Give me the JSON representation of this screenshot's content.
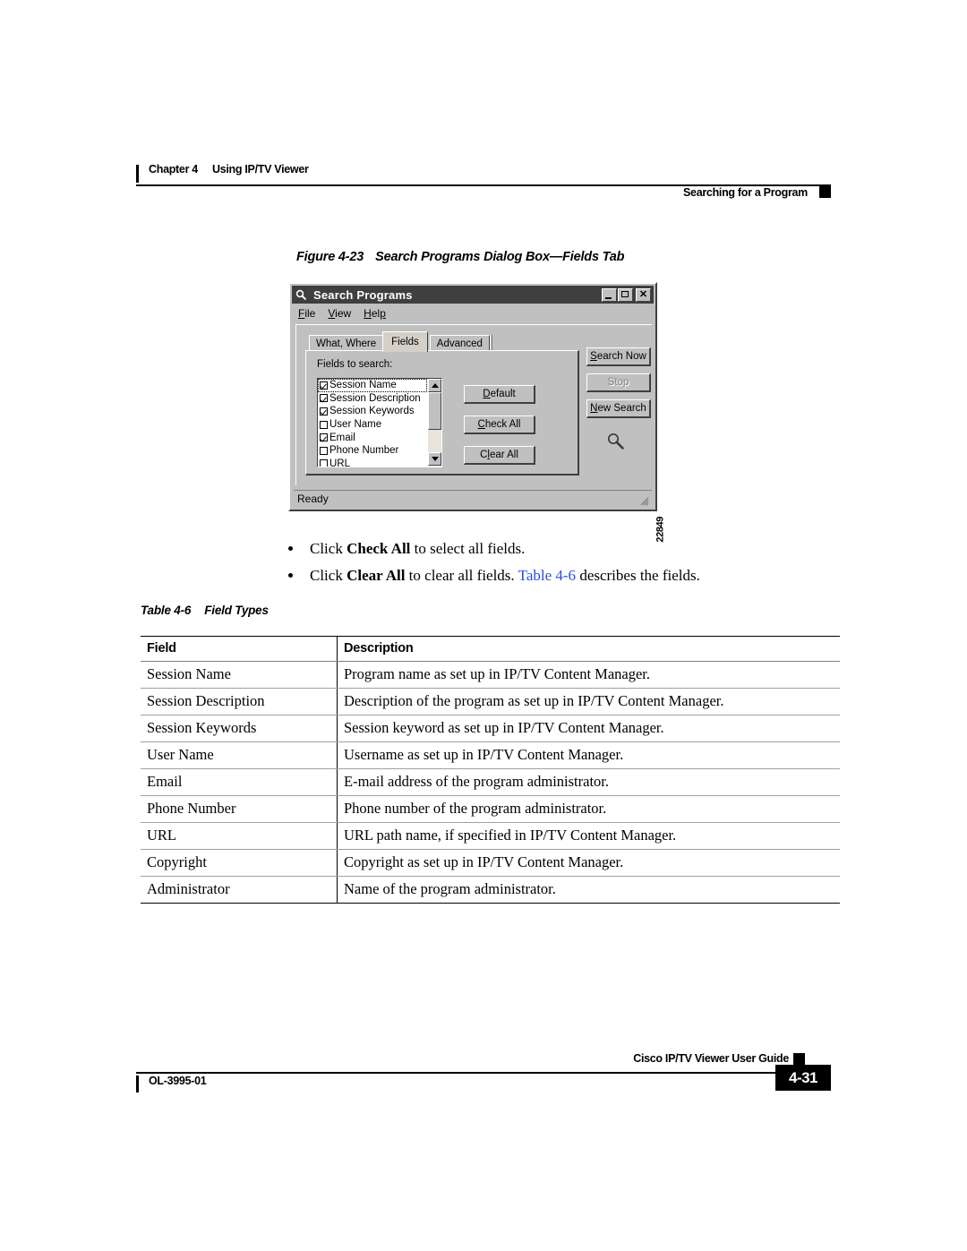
{
  "header": {
    "chapter_number": "Chapter 4",
    "chapter_title": "Using IP/TV Viewer",
    "section": "Searching for a Program"
  },
  "figure": {
    "number": "Figure 4-23",
    "title": "Search Programs Dialog Box—Fields Tab",
    "figure_id": "22849"
  },
  "dialog": {
    "title": "Search Programs",
    "titlebar_icon": "magnifier-icon",
    "window_buttons": {
      "minimize": "minimize-icon",
      "maximize": "maximize-icon",
      "close": "close-icon"
    },
    "menus": [
      {
        "label": "File",
        "mnemonic": "F"
      },
      {
        "label": "View",
        "mnemonic": "V"
      },
      {
        "label": "Help",
        "mnemonic": "H"
      }
    ],
    "tabs": [
      {
        "label": "What, Where",
        "active": false
      },
      {
        "label": "Fields",
        "active": true
      },
      {
        "label": "Advanced",
        "active": false
      }
    ],
    "fields_label": "Fields to search:",
    "field_list": [
      {
        "label": "Session Name",
        "checked": true,
        "focused": true
      },
      {
        "label": "Session Description",
        "checked": true,
        "focused": false
      },
      {
        "label": "Session Keywords",
        "checked": true,
        "focused": false
      },
      {
        "label": "User Name",
        "checked": false,
        "focused": false
      },
      {
        "label": "Email",
        "checked": true,
        "focused": false
      },
      {
        "label": "Phone Number",
        "checked": false,
        "focused": false
      },
      {
        "label": "URL",
        "checked": false,
        "focused": false
      }
    ],
    "list_buttons": [
      {
        "label": "Default",
        "mnemonic": "D",
        "enabled": true
      },
      {
        "label": "Check All",
        "mnemonic": "C",
        "enabled": true
      },
      {
        "label": "Clear All",
        "mnemonic": "l",
        "enabled": true
      }
    ],
    "side_buttons": [
      {
        "label": "Search Now",
        "mnemonic": "S",
        "enabled": true
      },
      {
        "label": "Stop",
        "mnemonic": "",
        "enabled": false
      },
      {
        "label": "New Search",
        "mnemonic": "N",
        "enabled": true
      }
    ],
    "search_icon": "magnifier-icon",
    "status_text": "Ready"
  },
  "bullets": [
    {
      "pre": "Click ",
      "bold": "Check All",
      "post": " to select all fields.",
      "link": "",
      "tail": ""
    },
    {
      "pre": "Click ",
      "bold": "Clear All",
      "post": " to clear all fields. ",
      "link": "Table 4-6",
      "tail": " describes the fields."
    }
  ],
  "table": {
    "caption_number": "Table 4-6",
    "caption_title": "Field Types",
    "columns": [
      "Field",
      "Description"
    ],
    "rows": [
      [
        "Session Name",
        "Program name as set up in IP/TV Content Manager."
      ],
      [
        "Session Description",
        "Description of the program as set up in IP/TV Content Manager."
      ],
      [
        "Session Keywords",
        "Session keyword as set up in IP/TV Content Manager."
      ],
      [
        "User Name",
        "Username as set up in IP/TV Content Manager."
      ],
      [
        "Email",
        "E-mail address of the program administrator."
      ],
      [
        "Phone Number",
        "Phone number of the program administrator."
      ],
      [
        "URL",
        "URL path name, if specified in IP/TV Content Manager."
      ],
      [
        "Copyright",
        "Copyright as set up in IP/TV Content Manager."
      ],
      [
        "Administrator",
        "Name of the program administrator."
      ]
    ]
  },
  "footer": {
    "guide_title": "Cisco IP/TV Viewer User Guide",
    "doc_id": "OL-3995-01",
    "page_number": "4-31"
  }
}
